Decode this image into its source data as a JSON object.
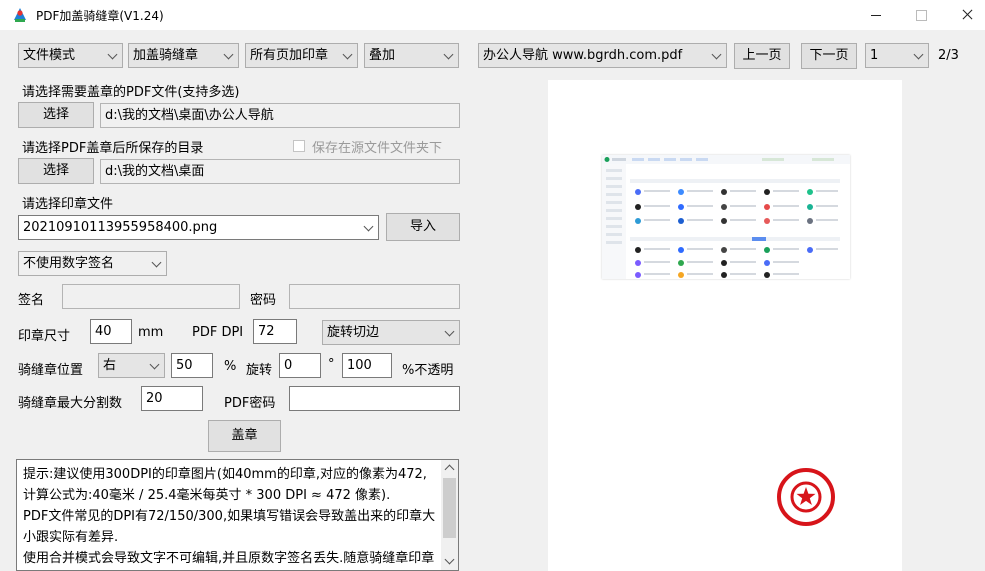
{
  "window": {
    "title": "PDF加盖骑缝章(V1.24)"
  },
  "toolbar": {
    "mode": "文件模式",
    "action": "加盖骑缝章",
    "pages": "所有页加印章",
    "overlay": "叠加",
    "file": "办公人导航 www.bgrdh.com.pdf",
    "prev_label": "上一页",
    "next_label": "下一页",
    "page_select": "1",
    "page_count": "2/3"
  },
  "source": {
    "label": "请选择需要盖章的PDF文件(支持多选)",
    "choose_label": "选择",
    "path": "d:\\我的文档\\桌面\\办公人导航"
  },
  "output": {
    "label": "请选择PDF盖章后所保存的目录",
    "same_folder_label": "保存在源文件文件夹下",
    "choose_label": "选择",
    "path": "d:\\我的文档\\桌面"
  },
  "seal": {
    "label": "请选择印章文件",
    "file": "20210910113955958400.png",
    "import_label": "导入"
  },
  "signature": {
    "mode": "不使用数字签名",
    "sign_label": "签名",
    "sign_value": "",
    "password_label": "密码",
    "password_value": ""
  },
  "params": {
    "size_label": "印章尺寸",
    "size_value": "40",
    "size_unit": "mm",
    "dpi_label": "PDF DPI",
    "dpi_value": "72",
    "rotate_mode": "旋转切边",
    "position_label": "骑缝章位置",
    "position_value": "右",
    "percent_value": "50",
    "percent_sign": "%",
    "rotate_label": "旋转",
    "rotate_value": "0",
    "degree_sign": "°",
    "opacity_value": "100",
    "opacity_label": "%不透明",
    "max_split_label": "骑缝章最大分割数",
    "max_split_value": "20",
    "pdf_password_label": "PDF密码",
    "pdf_password_value": ""
  },
  "stamp_button": "盖章",
  "tips": "提示:建议使用300DPI的印章图片(如40mm的印章,对应的像素为472,计算公式为:40毫米 / 25.4毫米每英寸 * 300 DPI ≈ 472 像素).\nPDF文件常见的DPI有72/150/300,如果填写错误会导致盖出来的印章大小跟实际有差异.\n使用合并模式会导致文字不可编辑,并且原数字签名丢失.随意骑缝章印章方头如印章此用在这的预览文件,所以同时使用时以后会过去,请",
  "colors": {
    "stamp_red": "#d7141a",
    "accent": "#0078d7"
  }
}
